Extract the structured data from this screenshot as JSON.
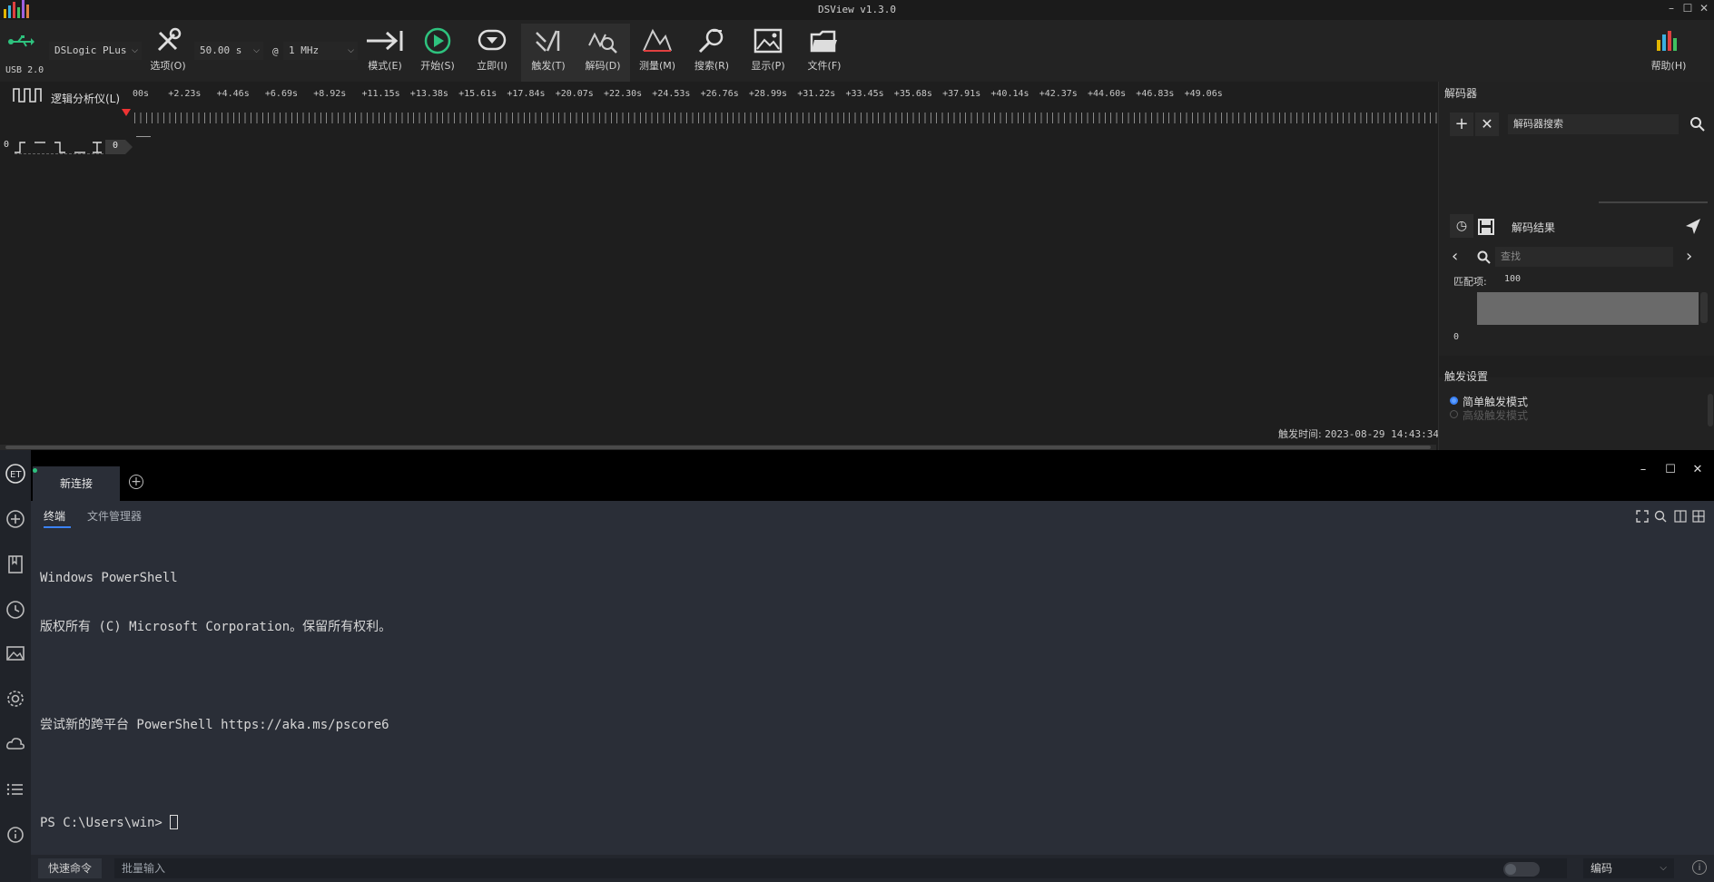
{
  "dsview": {
    "title": "DSView v1.3.0",
    "usb_label": "USB 2.0",
    "device": "DSLogic PLus",
    "duration": "50.00 s",
    "at_symbol": "@",
    "samplerate": "1 MHz",
    "tools": {
      "options": "选项(O)",
      "mode": "模式(E)",
      "start": "开始(S)",
      "instant": "立即(I)",
      "trigger": "触发(T)",
      "decode": "解码(D)",
      "measure": "测量(M)",
      "search": "搜索(R)",
      "display": "显示(P)",
      "file": "文件(F)",
      "help": "帮助(H)"
    },
    "analyzer_tab": "逻辑分析仪(L)",
    "ruler_ticks": [
      "00s",
      "+2.23s",
      "+4.46s",
      "+6.69s",
      "+8.92s",
      "+11.15s",
      "+13.38s",
      "+15.61s",
      "+17.84s",
      "+20.07s",
      "+22.30s",
      "+24.53s",
      "+26.76s",
      "+28.99s",
      "+31.22s",
      "+33.45s",
      "+35.68s",
      "+37.91s",
      "+40.14s",
      "+42.37s",
      "+44.60s",
      "+46.83s",
      "+49.06s"
    ],
    "channel_index": "0",
    "channel_badge": "0",
    "trigger_time_label": "触发时间:",
    "trigger_time_value": "2023-08-29 14:43:34",
    "dock": {
      "decoder_title": "解码器",
      "decoder_search": "解码器搜索",
      "decode_result": "解码结果",
      "find_placeholder": "查找",
      "match_label": "匹配项:",
      "match_value": "100",
      "result_row_index": "0",
      "trigger_settings": "触发设置",
      "simple_trigger": "简单触发模式",
      "advanced_trigger": "高级触发模式"
    }
  },
  "terminal": {
    "tab_label": "新连接",
    "subtabs": [
      "终端",
      "文件管理器"
    ],
    "output_lines": [
      "Windows PowerShell",
      "版权所有 (C) Microsoft Corporation。保留所有权利。",
      "",
      "尝试新的跨平台 PowerShell https://aka.ms/pscore6",
      ""
    ],
    "prompt": "PS C:\\Users\\win> ",
    "quick_cmd": "快速命令",
    "batch_placeholder": "批量输入",
    "encoding": "编码"
  },
  "colors": {
    "accent_green": "#2ec27e",
    "accent_blue": "#3b82f6",
    "record_red": "#e33333"
  }
}
